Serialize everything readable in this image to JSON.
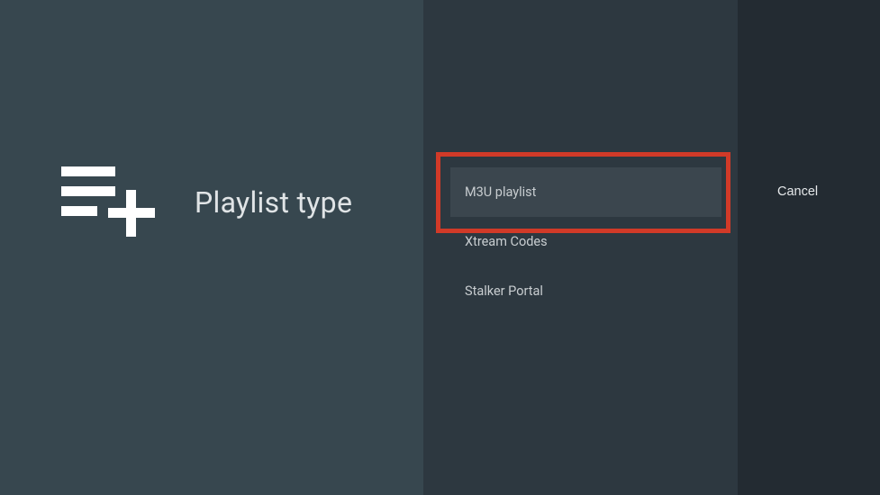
{
  "header": {
    "title": "Playlist type",
    "icon_name": "playlist-add-icon"
  },
  "options": [
    {
      "label": "M3U playlist",
      "selected": true
    },
    {
      "label": "Xtream Codes",
      "selected": false
    },
    {
      "label": "Stalker Portal",
      "selected": false
    }
  ],
  "actions": {
    "cancel_label": "Cancel"
  },
  "annotation": {
    "highlight_color": "#d13a28"
  }
}
